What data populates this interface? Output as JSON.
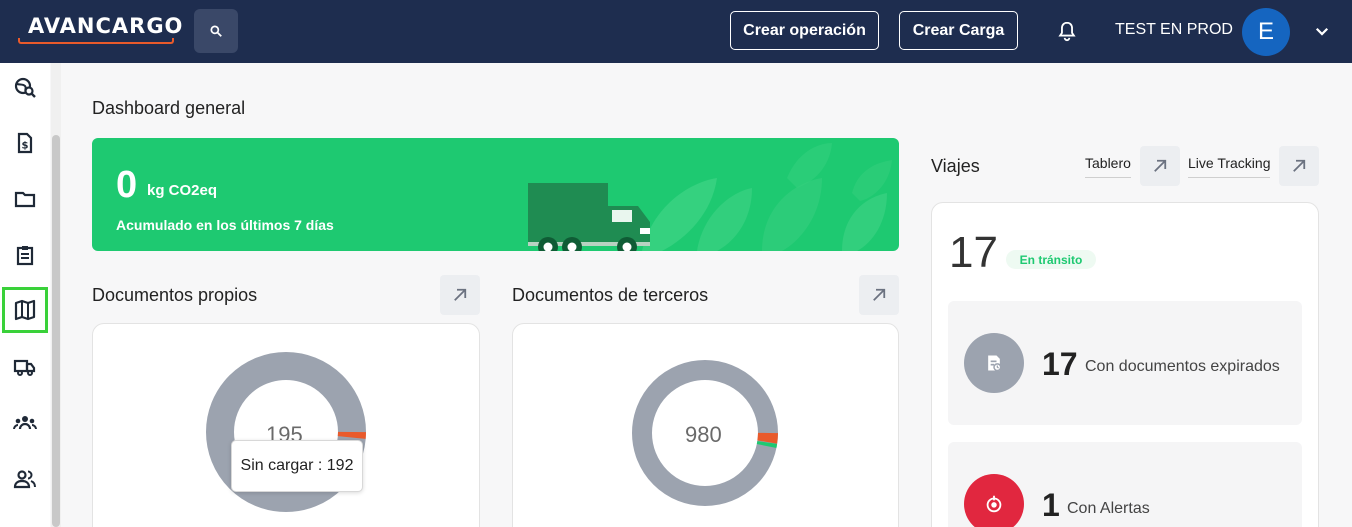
{
  "brand": {
    "logo_text": "AVANCARGO"
  },
  "header": {
    "create_operation": "Crear operación",
    "create_load": "Crear Carga",
    "user_name": "TEST EN PROD",
    "avatar_initial": "E"
  },
  "page": {
    "title": "Dashboard general"
  },
  "co2": {
    "value": "0",
    "unit": "kg CO2eq",
    "subtitle": "Acumulado en los últimos 7 días"
  },
  "own_docs": {
    "title": "Documentos propios",
    "total_label": "195",
    "tooltip": "Sin cargar : 192"
  },
  "third_docs": {
    "title": "Documentos de terceros",
    "total_label": "980"
  },
  "trips": {
    "title": "Viajes",
    "tab_board": "Tablero",
    "tab_live": "Live Tracking",
    "count": "17",
    "status_badge": "En tránsito",
    "expired": {
      "count": "17",
      "label": "Con documentos expirados"
    },
    "alerts": {
      "count": "1",
      "label": "Con Alertas"
    }
  },
  "colors": {
    "header_bg": "#1e2d4f",
    "accent_green": "#1ec971",
    "logo_orange": "#e95a2b",
    "active_outline": "#3ad13a",
    "alert_red": "#e1273f"
  }
}
